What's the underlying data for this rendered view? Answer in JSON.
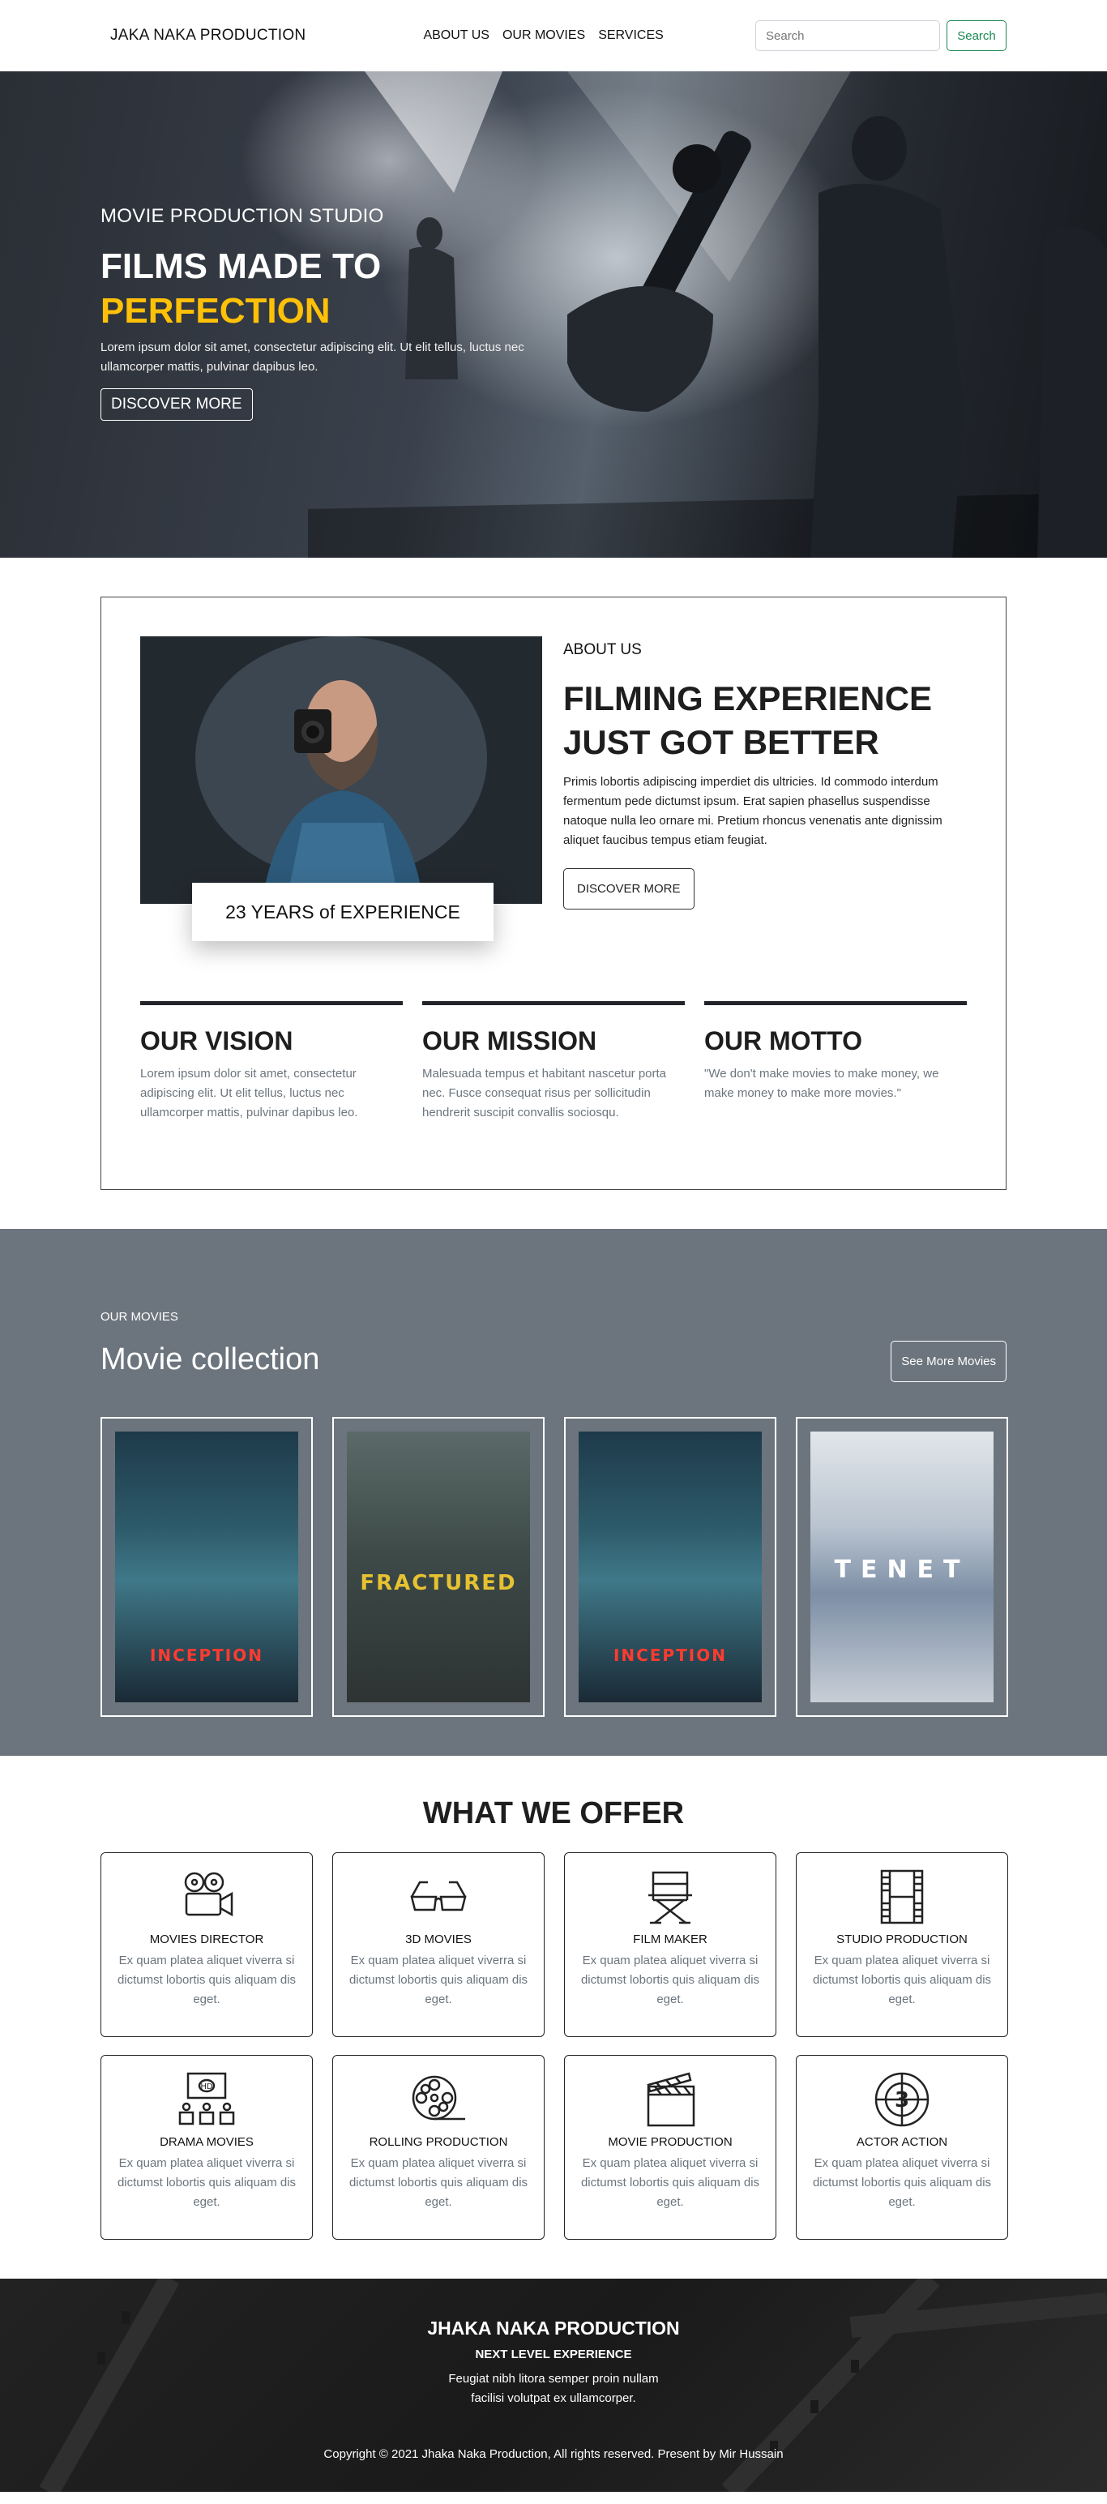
{
  "navbar": {
    "brand": "JAKA NAKA PRODUCTION",
    "links": [
      "ABOUT US",
      "OUR MOVIES",
      "SERVICES"
    ],
    "search_placeholder": "Search",
    "search_button": "Search"
  },
  "hero": {
    "kicker": "MOVIE PRODUCTION STUDIO",
    "title_line1": "FILMS MADE TO",
    "title_line2": "PERFECTION",
    "description": "Lorem ipsum dolor sit amet, consectetur adipiscing elit. Ut elit tellus, luctus nec ullamcorper mattis, pulvinar dapibus leo.",
    "button": "DISCOVER MORE"
  },
  "about": {
    "experience": "23 YEARS of EXPERIENCE",
    "kicker": "ABOUT US",
    "title": "FILMING EXPERIENCE JUST GOT BETTER",
    "text": "Primis lobortis adipiscing imperdiet dis ultricies. Id commodo interdum fermentum pede dictumst ipsum. Erat sapien phasellus suspendisse natoque nulla leo ornare mi. Pretium rhoncus venenatis ante dignissim aliquet faucibus tempus etiam feugiat.",
    "button": "DISCOVER MORE",
    "columns": [
      {
        "title": "OUR VISION",
        "text": "Lorem ipsum dolor sit amet, consectetur adipiscing elit. Ut elit tellus, luctus nec ullamcorper mattis, pulvinar dapibus leo."
      },
      {
        "title": "OUR MISSION",
        "text": "Malesuada tempus et habitant nascetur porta nec. Fusce consequat risus per sollicitudin hendrerit suscipit convallis sociosqu."
      },
      {
        "title": "OUR MOTTO",
        "text": "\"We don't make movies to make money, we make money to make more movies.\""
      }
    ]
  },
  "movies": {
    "kicker": "OUR MOVIES",
    "title": "Movie collection",
    "see_more": "See More Movies",
    "posters": [
      "INCEPTION",
      "FRACTURED",
      "INCEPTION",
      "TENET"
    ]
  },
  "offer": {
    "title": "WHAT WE OFFER",
    "items": [
      {
        "name": "MOVIES DIRECTOR",
        "icon": "movie-camera-icon",
        "text": "Ex quam platea aliquet viverra si dictumst lobortis quis aliquam dis eget."
      },
      {
        "name": "3D MOVIES",
        "icon": "3d-glasses-icon",
        "text": "Ex quam platea aliquet viverra si dictumst lobortis quis aliquam dis eget."
      },
      {
        "name": "FILM MAKER",
        "icon": "director-chair-icon",
        "text": "Ex quam platea aliquet viverra si dictumst lobortis quis aliquam dis eget."
      },
      {
        "name": "STUDIO PRODUCTION",
        "icon": "film-strip-icon",
        "text": "Ex quam platea aliquet viverra si dictumst lobortis quis aliquam dis eget."
      },
      {
        "name": "DRAMA MOVIES",
        "icon": "hd-screen-icon",
        "text": "Ex quam platea aliquet viverra si dictumst lobortis quis aliquam dis eget."
      },
      {
        "name": "ROLLING PRODUCTION",
        "icon": "film-reel-icon",
        "text": "Ex quam platea aliquet viverra si dictumst lobortis quis aliquam dis eget."
      },
      {
        "name": "MOVIE PRODUCTION",
        "icon": "clapperboard-icon",
        "text": "Ex quam platea aliquet viverra si dictumst lobortis quis aliquam dis eget."
      },
      {
        "name": "ACTOR ACTION",
        "icon": "countdown-icon",
        "text": "Ex quam platea aliquet viverra si dictumst lobortis quis aliquam dis eget."
      }
    ]
  },
  "footer": {
    "title": "JHAKA NAKA PRODUCTION",
    "subtitle": "NEXT LEVEL EXPERIENCE",
    "description": "Feugiat nibh litora semper proin nullam facilisi volutpat ex ullamcorper.",
    "copyright": "Copyright © 2021 Jhaka Naka Production, All rights reserved. Present by Mir Hussain"
  },
  "colors": {
    "accent_yellow": "#ffc107",
    "search_green": "#198754",
    "movies_bg": "#6c757d",
    "muted_text": "#6c757d"
  }
}
